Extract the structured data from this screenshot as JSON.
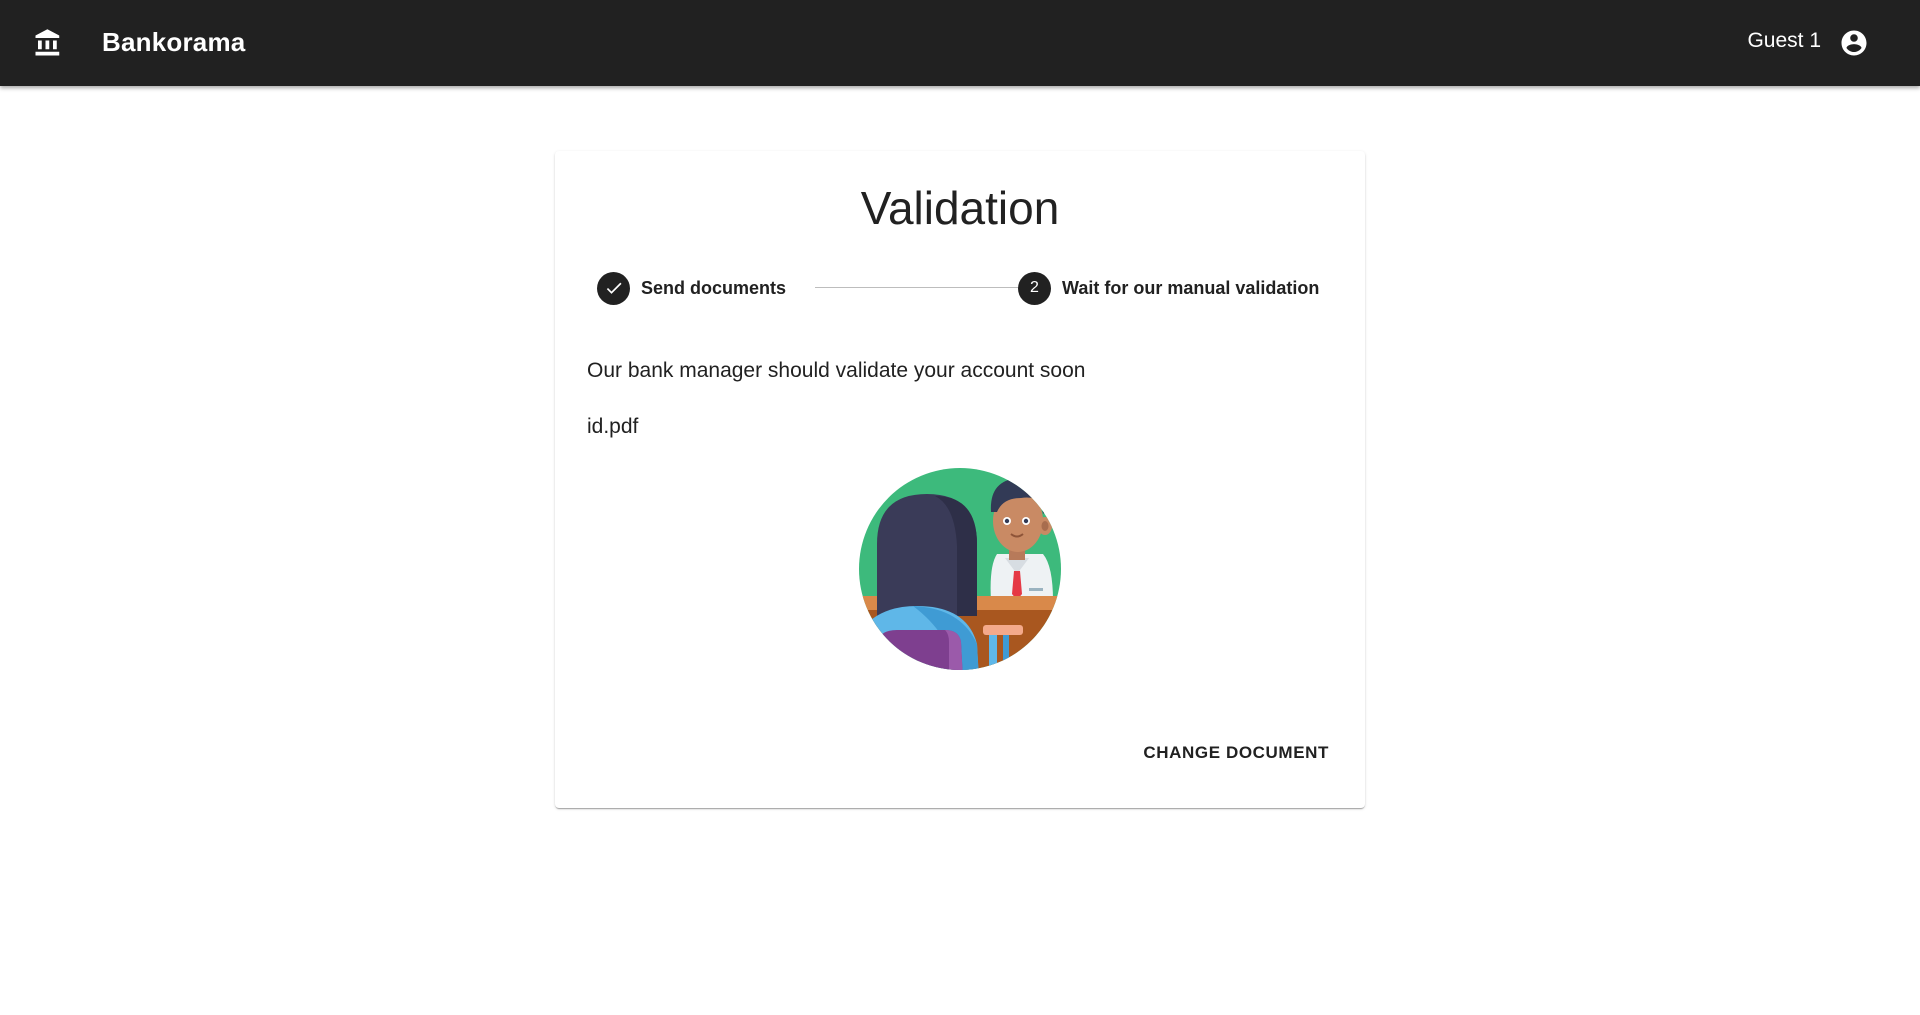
{
  "app": {
    "brand": "Bankorama",
    "brand_icon": "bank-icon",
    "user_name": "Guest 1",
    "user_icon": "account-circle-icon"
  },
  "card": {
    "title": "Validation",
    "steps": [
      {
        "label": "Send documents",
        "state": "completed",
        "icon": "check-icon"
      },
      {
        "label": "Wait for our manual validation",
        "state": "active",
        "number": "2"
      }
    ],
    "message": "Our bank manager should validate your account soon",
    "filename": "id.pdf",
    "illustration": "bank-manager-meeting-illustration",
    "change_button": "CHANGE DOCUMENT"
  },
  "colors": {
    "appbar": "#212121",
    "text": "#212121",
    "illustration_bg": "#3dba7c"
  }
}
